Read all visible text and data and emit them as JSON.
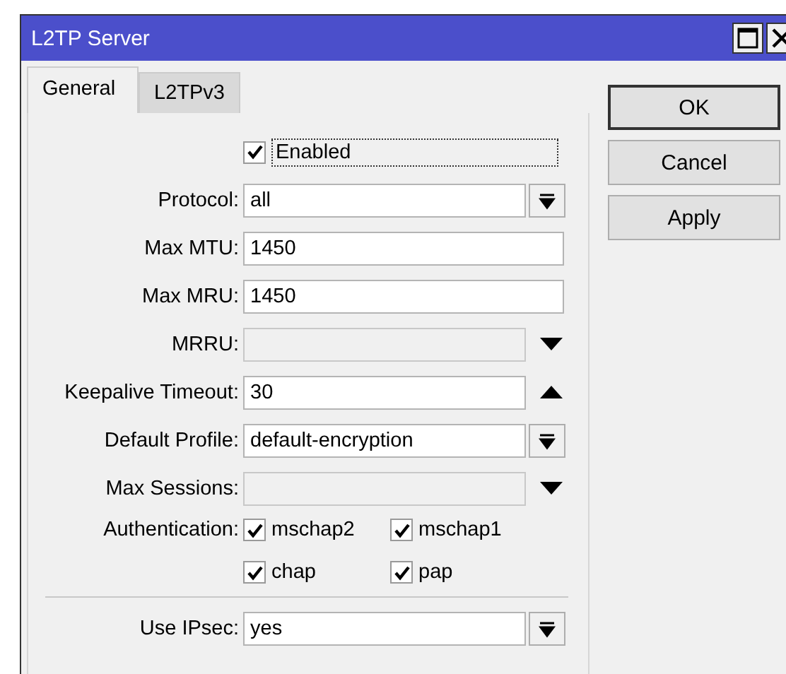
{
  "window": {
    "title": "L2TP Server"
  },
  "tabs": [
    {
      "label": "General",
      "selected": true
    },
    {
      "label": "L2TPv3",
      "selected": false
    }
  ],
  "enabled": {
    "label": "Enabled",
    "checked": true
  },
  "fields": [
    {
      "label": "Protocol:",
      "value": "all",
      "kind": "dropdown"
    },
    {
      "label": "Max MTU:",
      "value": "1450",
      "kind": "text"
    },
    {
      "label": "Max MRU:",
      "value": "1450",
      "kind": "text"
    },
    {
      "label": "MRRU:",
      "kind": "unset"
    },
    {
      "label": "Keepalive Timeout:",
      "value": "30",
      "kind": "set"
    },
    {
      "label": "Default Profile:",
      "value": "default-encryption",
      "kind": "dropdown"
    },
    {
      "label": "Max Sessions:",
      "kind": "unset"
    }
  ],
  "authentication": {
    "label": "Authentication:",
    "options": [
      {
        "label": "mschap2",
        "checked": true
      },
      {
        "label": "mschap1",
        "checked": true
      },
      {
        "label": "chap",
        "checked": true
      },
      {
        "label": "pap",
        "checked": true
      }
    ]
  },
  "ipsec": {
    "label": "Use IPsec:",
    "value": "yes",
    "kind": "dropdown"
  },
  "buttons": [
    "OK",
    "Cancel",
    "Apply"
  ]
}
